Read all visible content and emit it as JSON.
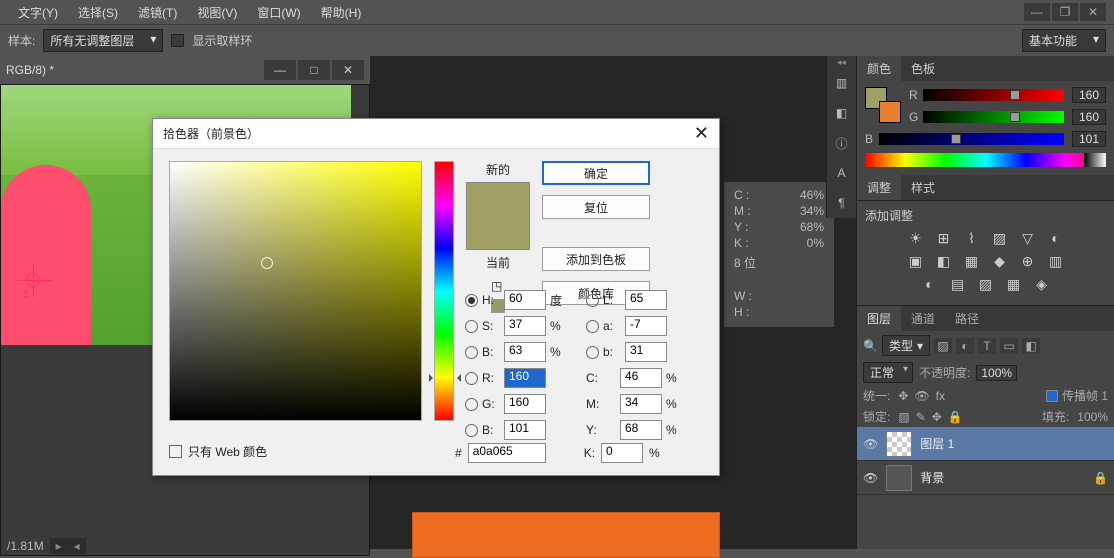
{
  "menubar": {
    "items": [
      "文字(Y)",
      "选择(S)",
      "滤镜(T)",
      "视图(V)",
      "窗口(W)",
      "帮助(H)"
    ]
  },
  "optsbar": {
    "sample_label": "样本:",
    "sample_value": "所有无调整图层",
    "show_ring_label": "显示取样环",
    "workspace": "基本功能"
  },
  "document": {
    "tab_title": "RGB/8) *",
    "status": "/1.81M",
    "guide_num": "1"
  },
  "info": {
    "rows": [
      {
        "label": "C :",
        "value": "46%"
      },
      {
        "label": "M :",
        "value": "34%"
      },
      {
        "label": "Y :",
        "value": "68%"
      },
      {
        "label": "K :",
        "value": "0%"
      }
    ],
    "bits": "8 位",
    "wh": [
      {
        "label": "W :",
        "value": ""
      },
      {
        "label": "H :",
        "value": ""
      }
    ]
  },
  "color_panel": {
    "tab_color": "颜色",
    "tab_swatch": "色板",
    "r": "160",
    "g": "160",
    "b": "101"
  },
  "adjust_panel": {
    "tab_adjust": "调整",
    "tab_styles": "样式",
    "title": "添加调整"
  },
  "layers_panel": {
    "tab_layers": "图层",
    "tab_channels": "通道",
    "tab_paths": "路径",
    "filter_mode": "类型",
    "blend_mode": "正常",
    "opacity_label": "不透明度:",
    "opacity_value": "100%",
    "unify_label": "统一:",
    "propagate_label": "传播帧 1",
    "lock_label": "锁定:",
    "fill_label": "填充:",
    "fill_value": "100%",
    "layers": [
      {
        "name": "图层 1"
      },
      {
        "name": "背景"
      }
    ]
  },
  "color_picker": {
    "title": "拾色器（前景色）",
    "new_label": "新的",
    "current_label": "当前",
    "btn_ok": "确定",
    "btn_reset": "复位",
    "btn_add": "添加到色板",
    "btn_lib": "颜色库",
    "web_only": "只有 Web 颜色",
    "hex": "a0a065",
    "H": "60",
    "H_unit": "度",
    "S": "37",
    "S_unit": "%",
    "Bv": "63",
    "Bv_unit": "%",
    "R": "160",
    "G": "160",
    "Bb": "101",
    "L": "65",
    "a": "-7",
    "b_lab": "31",
    "C": "46",
    "M": "34",
    "Y": "68",
    "K": "0"
  }
}
